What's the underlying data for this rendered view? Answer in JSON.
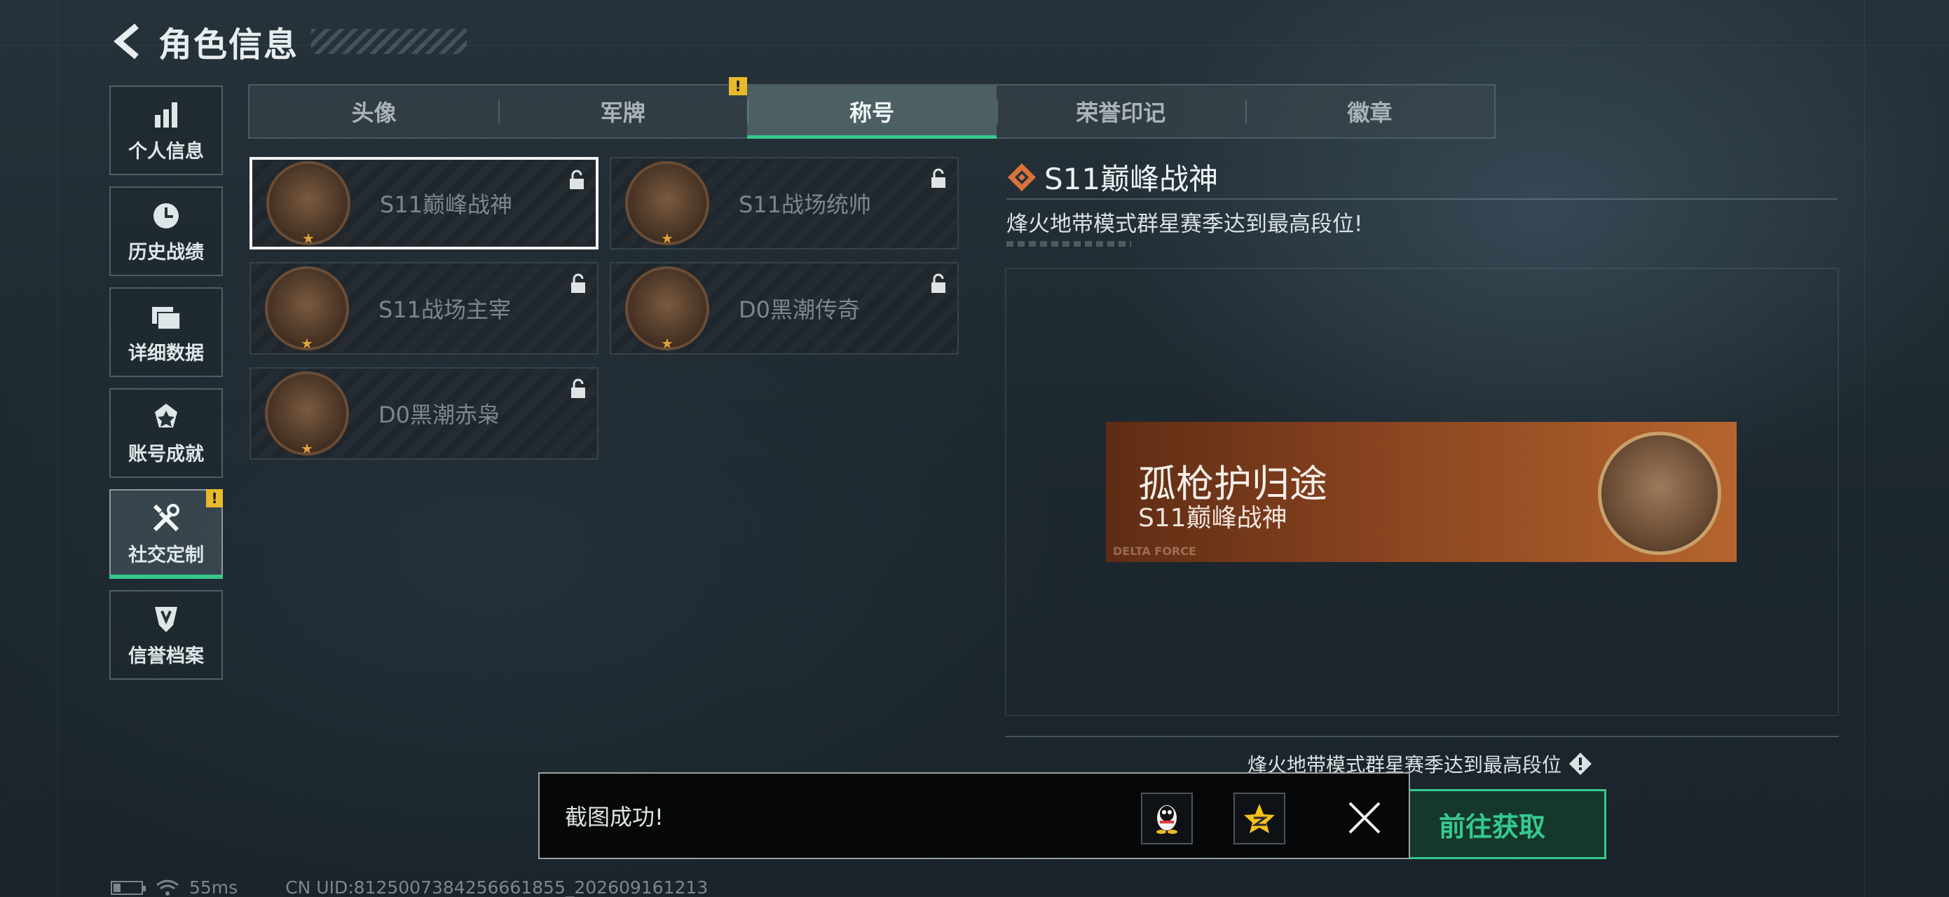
{
  "header": {
    "title": "角色信息"
  },
  "sidebar": {
    "items": [
      {
        "label": "个人信息",
        "icon": "bar-chart-icon"
      },
      {
        "label": "历史战绩",
        "icon": "clock-icon"
      },
      {
        "label": "详细数据",
        "icon": "folder-icon"
      },
      {
        "label": "账号成就",
        "icon": "medal-icon"
      },
      {
        "label": "社交定制",
        "icon": "tools-icon",
        "active": true,
        "badge": "!"
      },
      {
        "label": "信誉档案",
        "icon": "shield-icon"
      }
    ]
  },
  "tabs": [
    {
      "label": "头像"
    },
    {
      "label": "军牌",
      "badge": "!"
    },
    {
      "label": "称号",
      "active": true
    },
    {
      "label": "荣誉印记"
    },
    {
      "label": "徽章"
    }
  ],
  "titles": [
    {
      "name": "S11巅峰战神",
      "selected": true,
      "locked": true
    },
    {
      "name": "S11战场统帅",
      "locked": true
    },
    {
      "name": "S11战场主宰",
      "locked": true
    },
    {
      "name": "D0黑潮传奇",
      "locked": true
    },
    {
      "name": "D0黑潮赤枭",
      "locked": true
    }
  ],
  "detail": {
    "title": "S11巅峰战神",
    "description": "烽火地带模式群星赛季达到最高段位!",
    "banner_main": "孤枪护归途",
    "banner_sub": "S11巅峰战神",
    "banner_mark": "DELTA FORCE",
    "requirement": "烽火地带模式群星赛季达到最高段位",
    "goto_label": "前往获取"
  },
  "toast": {
    "text": "截图成功!"
  },
  "status": {
    "ping": "55ms",
    "uid": "CN UID:8125007384256661855_202609161213"
  },
  "colors": {
    "accent": "#35c98e",
    "badge": "#e8b92c",
    "banner": "#8a4420"
  }
}
